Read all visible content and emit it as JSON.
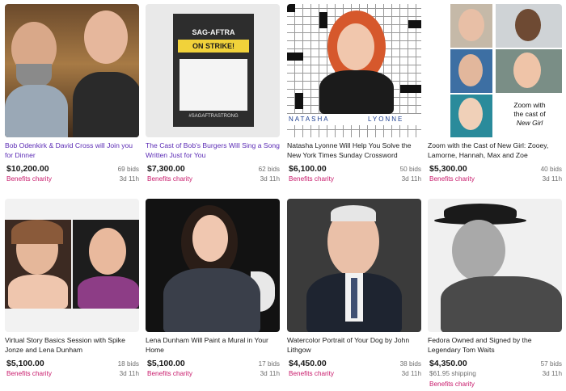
{
  "listings": [
    {
      "title": "Bob Odenkirk & David Cross will Join you for Dinner",
      "price": "$10,200.00",
      "bids": "69 bids",
      "charity": "Benefits charity",
      "time_left": "3d 11h",
      "visited": true
    },
    {
      "title": "The Cast of Bob's Burgers Will Sing a Song Written Just for You",
      "price": "$7,300.00",
      "bids": "62 bids",
      "charity": "Benefits charity",
      "time_left": "3d 11h",
      "visited": true,
      "image_text": {
        "line1": "SAG-AFTRA",
        "line2": "ON STRIKE!",
        "hashtag": "#SAGAFTRASTRONG"
      }
    },
    {
      "title": "Natasha Lyonne Will Help You Solve the New York Times Sunday Crossword",
      "price": "$6,100.00",
      "bids": "50 bids",
      "charity": "Benefits charity",
      "time_left": "3d 11h",
      "visited": false,
      "image_text": {
        "left": "NATASHA",
        "right": "LYONNE"
      }
    },
    {
      "title": "Zoom with the Cast of New Girl: Zooey, Lamorne, Hannah, Max and Zoe",
      "price": "$5,300.00",
      "bids": "40 bids",
      "charity": "Benefits charity",
      "time_left": "3d 11h",
      "visited": false,
      "image_text": {
        "line1": "Zoom with",
        "line2": "the cast of",
        "line3": "New Girl"
      }
    },
    {
      "title": "Virtual Story Basics Session with Spike Jonze and Lena Dunham",
      "price": "$5,100.00",
      "bids": "18 bids",
      "charity": "Benefits charity",
      "time_left": "3d 11h",
      "visited": false
    },
    {
      "title": "Lena Dunham Will Paint a Mural in Your Home",
      "price": "$5,100.00",
      "bids": "17 bids",
      "charity": "Benefits charity",
      "time_left": "3d 11h",
      "visited": false
    },
    {
      "title": "Watercolor Portrait of Your Dog by John Lithgow",
      "price": "$4,450.00",
      "bids": "38 bids",
      "charity": "Benefits charity",
      "time_left": "3d 11h",
      "visited": false
    },
    {
      "title": "Fedora Owned and Signed by the Legendary Tom Waits",
      "price": "$4,350.00",
      "bids": "57 bids",
      "shipping": "$61.95 shipping",
      "charity": "Benefits charity",
      "time_left": "3d 11h",
      "visited": false
    }
  ]
}
